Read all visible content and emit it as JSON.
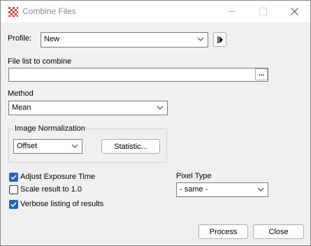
{
  "window": {
    "title": "Combine Files"
  },
  "profile": {
    "label": "Profile:",
    "value": "New"
  },
  "file_list": {
    "label": "File list to combine",
    "value": "",
    "browse_label": "..."
  },
  "method": {
    "label": "Method",
    "value": "Mean"
  },
  "normalization": {
    "group_title": "Image Normalization",
    "value": "Offset",
    "statistic_label": "Statistic..."
  },
  "options": {
    "adjust_exposure": {
      "label": "Adjust Exposure Time",
      "checked": true
    },
    "scale_result": {
      "label": "Scale result to 1.0",
      "checked": false
    },
    "verbose": {
      "label": "Verbose listing of results",
      "checked": true
    }
  },
  "pixel_type": {
    "label": "Pixel Type",
    "value": "- same -"
  },
  "buttons": {
    "process": "Process",
    "close": "Close"
  },
  "colors": {
    "accent": "#1f66c3",
    "icon": "#e0362f",
    "window_bg": "#f0f0f0"
  }
}
